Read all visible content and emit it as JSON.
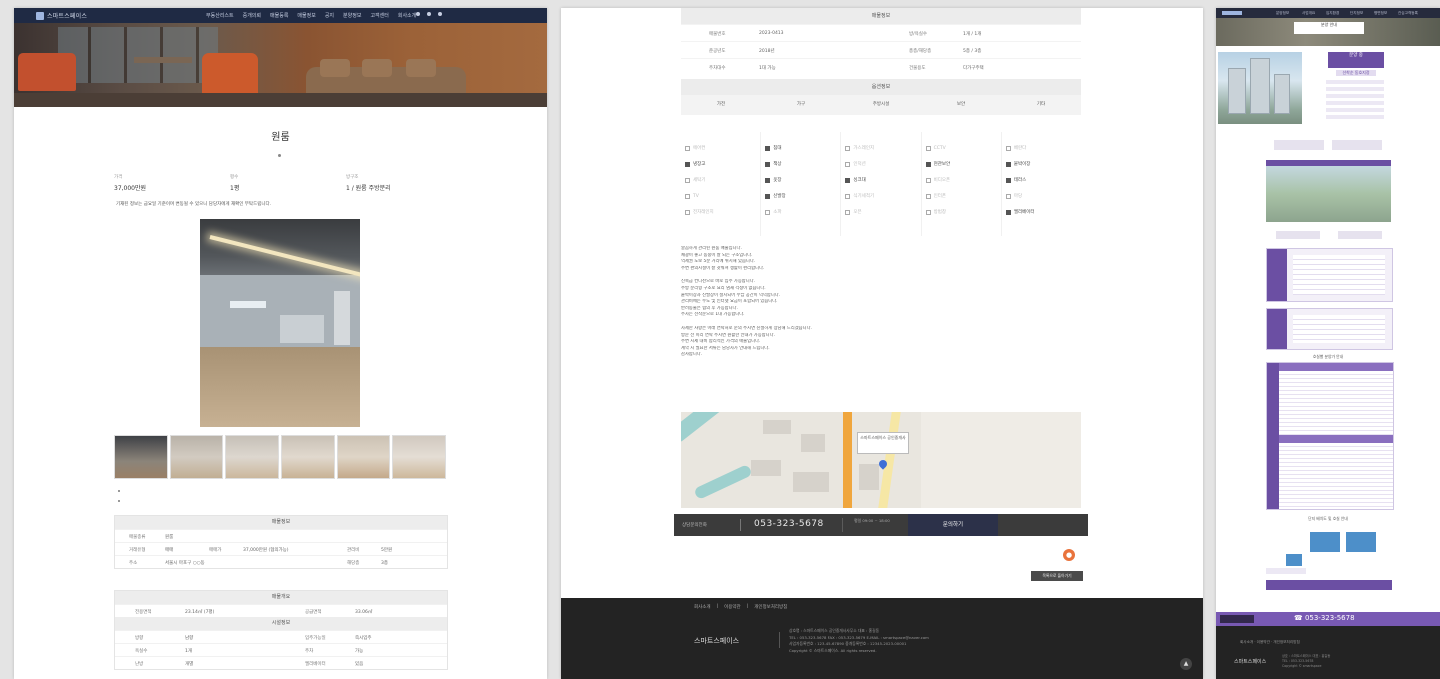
{
  "panel1": {
    "logo_text": "스마트스페이스",
    "nav": [
      "부동산리스트",
      "중개의뢰",
      "매물등록",
      "매물정보",
      "공지",
      "분양정보",
      "고객센터",
      "회사소개"
    ],
    "title": "원룸",
    "stats": [
      {
        "label": "가격",
        "value": "37,000만원"
      },
      {
        "label": "평수",
        "value": "1평"
      },
      {
        "label": "방구조",
        "value": "1 / 원룸 주방분리"
      }
    ],
    "description": "기재된 정보는 금요일 기준이며 변동될 수 있으니 담당자에게 재확인 부탁드립니다.",
    "table1": {
      "header": "매물정보",
      "rows": [
        {
          "k1": "매물종류",
          "v1": "원룸"
        },
        {
          "k1": "거래유형",
          "v1": "매매",
          "k2": "매매가",
          "v2": "37,000만원 (협의가능)",
          "k3": "관리비",
          "v3": "5만원"
        },
        {
          "k1": "주소",
          "v1": "서울시 마포구 ○○동",
          "k3": "해당층",
          "v3": "3층"
        }
      ]
    },
    "table2": {
      "header": "매물개요",
      "sub_header": "시설정보",
      "row1": {
        "k1": "전용면적",
        "v1": "23.14㎡ (7평)",
        "k2": "공급면적",
        "v2": "33.06㎡"
      },
      "rows": [
        {
          "k1": "방향",
          "v1": "남향",
          "k2": "입주가능일",
          "v2": "즉시입주"
        },
        {
          "k1": "욕실수",
          "v1": "1개",
          "k2": "주차",
          "v2": "가능"
        },
        {
          "k1": "난방",
          "v1": "개별",
          "k2": "엘리베이터",
          "v2": "있음"
        }
      ]
    }
  },
  "panel2": {
    "table_title": "매물정보",
    "kv": [
      {
        "k1": "매물번호",
        "v1": "2023-0413",
        "k2": "방/욕실수",
        "v2": "1개 / 1개"
      },
      {
        "k1": "준공년도",
        "v1": "2018년",
        "k2": "총층/해당층",
        "v2": "5층 / 3층"
      },
      {
        "k1": "주차대수",
        "v1": "1대 가능",
        "k2": "건물용도",
        "v2": "다가구주택"
      }
    ],
    "options_title": "옵션정보",
    "columns": [
      "가전",
      "가구",
      "주방시설",
      "보안",
      "기타"
    ],
    "options": [
      [
        {
          "t": "에어컨",
          "on": false
        },
        {
          "t": "냉장고",
          "on": true
        },
        {
          "t": "세탁기",
          "on": false
        },
        {
          "t": "TV",
          "on": false
        },
        {
          "t": "전자레인지",
          "on": false
        }
      ],
      [
        {
          "t": "침대",
          "on": true
        },
        {
          "t": "책상",
          "on": true
        },
        {
          "t": "옷장",
          "on": true
        },
        {
          "t": "신발장",
          "on": true
        },
        {
          "t": "소파",
          "on": false
        }
      ],
      [
        {
          "t": "가스레인지",
          "on": false
        },
        {
          "t": "인덕션",
          "on": false
        },
        {
          "t": "싱크대",
          "on": true
        },
        {
          "t": "식기세척기",
          "on": false
        },
        {
          "t": "오븐",
          "on": false
        }
      ],
      [
        {
          "t": "CCTV",
          "on": false
        },
        {
          "t": "현관보안",
          "on": true
        },
        {
          "t": "비디오폰",
          "on": false
        },
        {
          "t": "인터폰",
          "on": false
        },
        {
          "t": "방범창",
          "on": false
        }
      ],
      [
        {
          "t": "베란다",
          "on": false
        },
        {
          "t": "붙박이장",
          "on": true
        },
        {
          "t": "테라스",
          "on": true
        },
        {
          "t": "마당",
          "on": false
        },
        {
          "t": "엘리베이터",
          "on": true
        }
      ]
    ],
    "desc_paras": [
      [
        "깔끔하게 관리된 원룸 매물입니다.",
        "채광이 좋고 통풍이 잘 되는 구조입니다.",
        "역세권 도보 5분 거리에 위치해 있습니다.",
        "주변 편의시설이 잘 갖춰져 생활이 편리합니다."
      ],
      [
        "신축급 컨디션으로 바로 입주 가능합니다.",
        "주방 분리형 구조로 요리 냄새 걱정이 없습니다.",
        "붙박이장과 신발장이 설치되어 수납 공간이 넉넉합니다.",
        "관리비에는 수도 및 인터넷 요금이 포함되어 있습니다.",
        "반려동물은 협의 후 가능합니다.",
        "주차는 선착순으로 1대 가능합니다."
      ],
      [
        "자세한 사항은 아래 연락처로 문의 주시면 친절하게 상담해 드리겠습니다.",
        "방문 전 미리 연락 주시면 원활한 안내가 가능합니다.",
        "주변 시세 대비 합리적인 가격의 매물입니다.",
        "계약 시 필요한 서류는 담당자가 안내해 드립니다.",
        "감사합니다."
      ]
    ],
    "map_label": "스마트스페이스 공인중개사",
    "contact_label": "상담문의전화",
    "phone": "053-323-5678",
    "contact_mid": "평일 09:00 ~ 18:00",
    "contact_button": "문의하기",
    "action_button": "목록으로 돌아가기",
    "footer_links": [
      "회사소개",
      "이용약관",
      "개인정보처리방침"
    ],
    "footer_logo": "스마트스페이스",
    "footer_info": [
      "상호명 : 스마트스페이스 공인중개사사무소  대표 : 홍길동",
      "TEL : 053-323-5678   FAX : 053-323-5679   E-MAIL : smartspace@naver.com",
      "사업자등록번호 : 123-45-67890   중개등록번호 : 12345-2023-00001",
      "Copyright © 스마트스페이스. All rights reserved."
    ],
    "top_button": "▲"
  },
  "panel3": {
    "nav": [
      "분양정보",
      "사업개요",
      "입지환경",
      "단지정보",
      "평면정보",
      "관심고객등록"
    ],
    "hero_title": "분양 안내",
    "badge": "분양 중",
    "badge_sub": "선착순 동호지정",
    "caption1": "단지 배치도 및 호실 안내",
    "caption2": "호실별 분양가 안내",
    "cta_phone": "☎ 053-323-5678",
    "footer_links": "회사소개 · 이용약관 · 개인정보처리방침",
    "footer_logo": "스마트스페이스",
    "footer_info": [
      "상호 : 스마트스페이스 대표 : 홍길동",
      "TEL : 053-323-5678",
      "Copyright © smartspace"
    ]
  }
}
